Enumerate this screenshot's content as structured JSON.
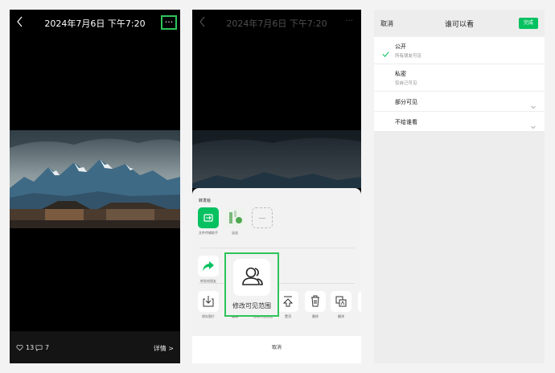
{
  "photo_view": {
    "title": "2024年7月6日 下午7:20",
    "more_label": "···",
    "likes": "13",
    "comments": "7",
    "details_label": "详情 >"
  },
  "share_sheet": {
    "title": "2024年7月6日 下午7:20",
    "more_label": "···",
    "section_title": "转发给",
    "contacts": [
      {
        "label": "文件传输助手",
        "icon": "file-transfer-icon"
      },
      {
        "label": "谈谈",
        "icon": "contact-avatar"
      },
      {
        "label": "",
        "icon": "more-contacts-placeholder"
      }
    ],
    "actions": [
      {
        "label": "转发给朋友",
        "icon": "forward-icon"
      }
    ],
    "toolbar": [
      {
        "label": "保存图片",
        "icon": "download-icon"
      },
      {
        "label": "编辑",
        "icon": "edit-icon"
      },
      {
        "label": "修改可见范围",
        "icon": "visibility-icon"
      },
      {
        "label": "置顶",
        "icon": "pin-top-icon"
      },
      {
        "label": "删除",
        "icon": "trash-icon"
      },
      {
        "label": "翻译",
        "icon": "translate-icon"
      }
    ],
    "popup_label": "修改可见范围",
    "cancel_label": "取消"
  },
  "visibility": {
    "cancel_label": "取消",
    "title": "谁可以看",
    "done_label": "完成",
    "options": [
      {
        "title": "公开",
        "subtitle": "所有朋友可见",
        "selected": true
      },
      {
        "title": "私密",
        "subtitle": "仅自己可见",
        "selected": false
      },
      {
        "title": "部分可见",
        "subtitle": "",
        "selected": false
      },
      {
        "title": "不给谁看",
        "subtitle": "",
        "selected": false
      }
    ]
  },
  "colors": {
    "accent_green": "#07c160",
    "highlight_green": "#2ec45a",
    "photo_background": "#000000"
  }
}
